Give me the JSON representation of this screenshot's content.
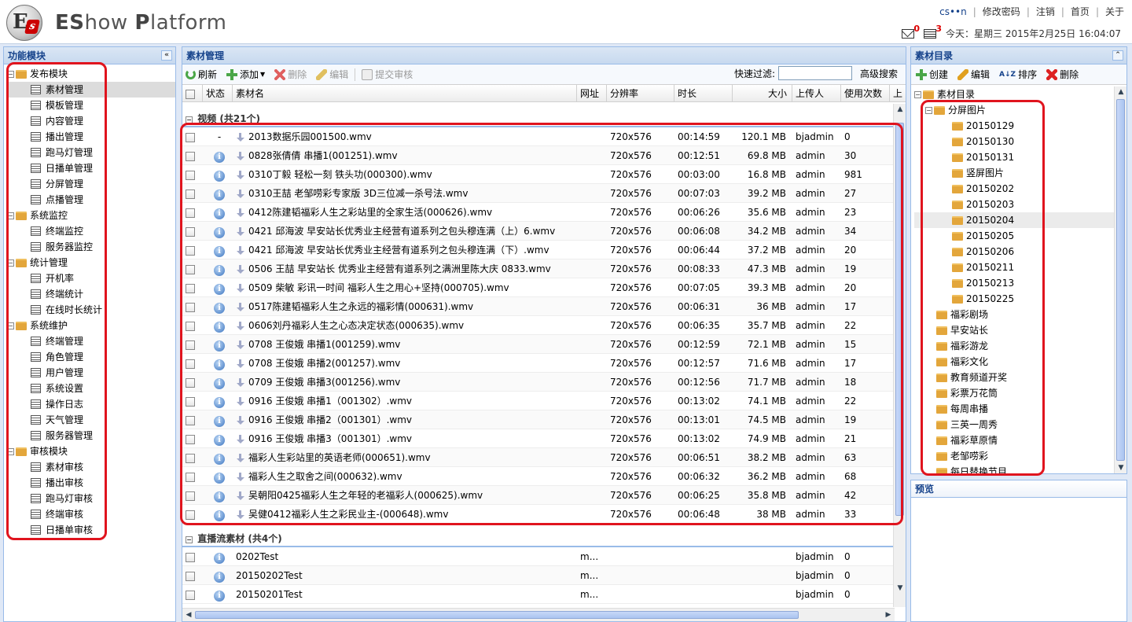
{
  "header": {
    "logo_letter": "E",
    "logo_sub": "s",
    "title_bold_1": "ES",
    "title_light_1": "how ",
    "title_bold_2": "P",
    "title_light_2": "latform",
    "user": "cs••n",
    "links": [
      "修改密码",
      "注销",
      "首页",
      "关于"
    ],
    "mail_count": "0",
    "notice_count": "3",
    "datetime": "今天：星期三 2015年2月25日 16:04:07"
  },
  "left": {
    "title": "功能模块",
    "groups": [
      {
        "label": "发布模块",
        "items": [
          "素材管理",
          "模板管理",
          "内容管理",
          "播出管理",
          "跑马灯管理",
          "日播单管理",
          "分屏管理",
          "点播管理"
        ]
      },
      {
        "label": "系统监控",
        "items": [
          "终端监控",
          "服务器监控"
        ]
      },
      {
        "label": "统计管理",
        "items": [
          "开机率",
          "终端统计",
          "在线时长统计"
        ]
      },
      {
        "label": "系统维护",
        "items": [
          "终端管理",
          "角色管理",
          "用户管理",
          "系统设置",
          "操作日志",
          "天气管理",
          "服务器管理"
        ]
      },
      {
        "label": "审核模块",
        "items": [
          "素材审核",
          "播出审核",
          "跑马灯审核",
          "终端审核",
          "日播单审核"
        ]
      }
    ]
  },
  "center": {
    "title": "素材管理",
    "toolbar": {
      "refresh": "刷新",
      "add": "添加",
      "delete": "删除",
      "edit": "编辑",
      "submit": "提交审核",
      "filter_label": "快速过滤:",
      "filter_value": "",
      "advanced": "高级搜索"
    },
    "columns": [
      "状态",
      "素材名",
      "网址",
      "分辨率",
      "时长",
      "大小",
      "上传人",
      "使用次数",
      "上"
    ],
    "group_video": "视频 (共21个)",
    "video_rows": [
      {
        "status": "-",
        "name": "2013数据乐园001500.wmv",
        "url": "",
        "res": "720x576",
        "dur": "00:14:59",
        "size": "120.1 MB",
        "uploader": "bjadmin",
        "uses": "0"
      },
      {
        "status": "i",
        "name": "0828张倩倩 串播1(001251).wmv",
        "url": "",
        "res": "720x576",
        "dur": "00:12:51",
        "size": "69.8 MB",
        "uploader": "admin",
        "uses": "30"
      },
      {
        "status": "i",
        "name": "0310丁毅 轻松一刻 铁头功(000300).wmv",
        "url": "",
        "res": "720x576",
        "dur": "00:03:00",
        "size": "16.8 MB",
        "uploader": "admin",
        "uses": "981"
      },
      {
        "status": "i",
        "name": "0310王喆 老邹唠彩专家版 3D三位减一杀号法.wmv",
        "url": "",
        "res": "720x576",
        "dur": "00:07:03",
        "size": "39.2 MB",
        "uploader": "admin",
        "uses": "27"
      },
      {
        "status": "i",
        "name": "0412陈建韬福彩人生之彩站里的全家生活(000626).wmv",
        "url": "",
        "res": "720x576",
        "dur": "00:06:26",
        "size": "35.6 MB",
        "uploader": "admin",
        "uses": "23"
      },
      {
        "status": "i",
        "name": "0421 邱海波 早安站长优秀业主经营有道系列之包头穆连满（上）6.wmv",
        "url": "",
        "res": "720x576",
        "dur": "00:06:08",
        "size": "34.2 MB",
        "uploader": "admin",
        "uses": "34"
      },
      {
        "status": "i",
        "name": "0421 邱海波 早安站长优秀业主经营有道系列之包头穆连满（下）.wmv",
        "url": "",
        "res": "720x576",
        "dur": "00:06:44",
        "size": "37.2 MB",
        "uploader": "admin",
        "uses": "20"
      },
      {
        "status": "i",
        "name": "0506 王喆 早安站长 优秀业主经营有道系列之满洲里陈大庆 0833.wmv",
        "url": "",
        "res": "720x576",
        "dur": "00:08:33",
        "size": "47.3 MB",
        "uploader": "admin",
        "uses": "19"
      },
      {
        "status": "i",
        "name": "0509 柴敏 彩讯一时间 福彩人生之用心+坚持(000705).wmv",
        "url": "",
        "res": "720x576",
        "dur": "00:07:05",
        "size": "39.3 MB",
        "uploader": "admin",
        "uses": "20"
      },
      {
        "status": "i",
        "name": "0517陈建韬福彩人生之永远的福彩情(000631).wmv",
        "url": "",
        "res": "720x576",
        "dur": "00:06:31",
        "size": "36 MB",
        "uploader": "admin",
        "uses": "17"
      },
      {
        "status": "i",
        "name": "0606刘丹福彩人生之心态决定状态(000635).wmv",
        "url": "",
        "res": "720x576",
        "dur": "00:06:35",
        "size": "35.7 MB",
        "uploader": "admin",
        "uses": "22"
      },
      {
        "status": "i",
        "name": "0708 王俊娥 串播1(001259).wmv",
        "url": "",
        "res": "720x576",
        "dur": "00:12:59",
        "size": "72.1 MB",
        "uploader": "admin",
        "uses": "15"
      },
      {
        "status": "i",
        "name": "0708 王俊娥 串播2(001257).wmv",
        "url": "",
        "res": "720x576",
        "dur": "00:12:57",
        "size": "71.6 MB",
        "uploader": "admin",
        "uses": "17"
      },
      {
        "status": "i",
        "name": "0709 王俊娥 串播3(001256).wmv",
        "url": "",
        "res": "720x576",
        "dur": "00:12:56",
        "size": "71.7 MB",
        "uploader": "admin",
        "uses": "18"
      },
      {
        "status": "i",
        "name": "0916 王俊娥 串播1（001302）.wmv",
        "url": "",
        "res": "720x576",
        "dur": "00:13:02",
        "size": "74.1 MB",
        "uploader": "admin",
        "uses": "22"
      },
      {
        "status": "i",
        "name": "0916 王俊娥 串播2（001301）.wmv",
        "url": "",
        "res": "720x576",
        "dur": "00:13:01",
        "size": "74.5 MB",
        "uploader": "admin",
        "uses": "19"
      },
      {
        "status": "i",
        "name": "0916 王俊娥 串播3（001301）.wmv",
        "url": "",
        "res": "720x576",
        "dur": "00:13:02",
        "size": "74.9 MB",
        "uploader": "admin",
        "uses": "21"
      },
      {
        "status": "i",
        "name": "福彩人生彩站里的英语老师(000651).wmv",
        "url": "",
        "res": "720x576",
        "dur": "00:06:51",
        "size": "38.2 MB",
        "uploader": "admin",
        "uses": "63"
      },
      {
        "status": "i",
        "name": "福彩人生之取舍之间(000632).wmv",
        "url": "",
        "res": "720x576",
        "dur": "00:06:32",
        "size": "36.2 MB",
        "uploader": "admin",
        "uses": "68"
      },
      {
        "status": "i",
        "name": "吴朝阳0425福彩人生之年轻的老福彩人(000625).wmv",
        "url": "",
        "res": "720x576",
        "dur": "00:06:25",
        "size": "35.8 MB",
        "uploader": "admin",
        "uses": "42"
      },
      {
        "status": "i",
        "name": "吴健0412福彩人生之彩民业主-(000648).wmv",
        "url": "",
        "res": "720x576",
        "dur": "00:06:48",
        "size": "38 MB",
        "uploader": "admin",
        "uses": "33"
      }
    ],
    "group_stream": "直播流素材 (共4个)",
    "stream_rows": [
      {
        "status": "i",
        "name": "0202Test",
        "url": "m...",
        "res": "",
        "dur": "",
        "size": "",
        "uploader": "bjadmin",
        "uses": "0"
      },
      {
        "status": "i",
        "name": "20150202Test",
        "url": "m...",
        "res": "",
        "dur": "",
        "size": "",
        "uploader": "bjadmin",
        "uses": "0"
      },
      {
        "status": "i",
        "name": "20150201Test",
        "url": "m...",
        "res": "",
        "dur": "",
        "size": "",
        "uploader": "bjadmin",
        "uses": "0"
      }
    ]
  },
  "right": {
    "title": "素材目录",
    "toolbar": {
      "create": "创建",
      "edit": "编辑",
      "sort": "排序",
      "delete": "删除"
    },
    "root": "素材目录",
    "split": "分屏图片",
    "split_children": [
      "20150129",
      "20150130",
      "20150131",
      "竖屏图片",
      "20150202",
      "20150203",
      "20150204",
      "20150205",
      "20150206",
      "20150211",
      "20150213",
      "20150225"
    ],
    "others": [
      "福彩剧场",
      "早安站长",
      "福彩游龙",
      "福彩文化",
      "教育频道开奖",
      "彩票万花筒",
      "每周串播",
      "三英一周秀",
      "福彩草原情",
      "老邹唠彩",
      "每日替换节目"
    ]
  },
  "preview": {
    "title": "预览"
  }
}
